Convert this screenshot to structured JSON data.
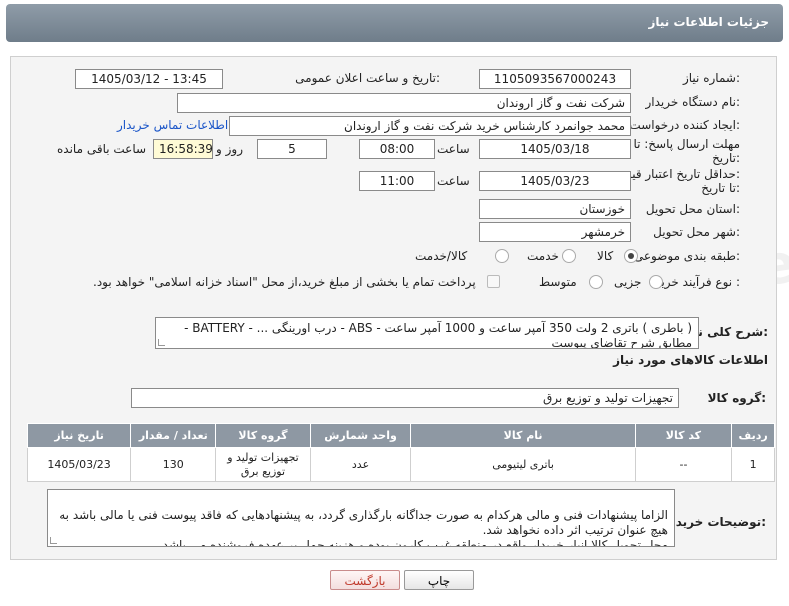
{
  "header": {
    "title": "جزئیات اطلاعات نیاز"
  },
  "form": {
    "need_number_label": "شماره نیاز:",
    "need_number": "1105093567000243",
    "announce_datetime_label": "تاریخ و ساعت اعلان عمومی:",
    "announce_datetime": "1405/03/12 - 13:45",
    "buyer_org_label": "نام دستگاه خریدار:",
    "buyer_org": "شرکت نفت و گاز اروندان",
    "requester_label": "ایجاد کننده درخواست:",
    "requester": "محمد جوانمرد کارشناس خرید شرکت نفت و گاز اروندان",
    "contact_link": "اطلاعات تماس خریدار",
    "reply_deadline_label_1": "مهلت ارسال پاسخ: تا",
    "reply_deadline_label_2": "تاریخ:",
    "reply_date": "1405/03/18",
    "time_label": "ساعت",
    "reply_time": "08:00",
    "days_value": "5",
    "days_label": "روز و",
    "remaining_time": "16:58:39",
    "remaining_label": "ساعت باقی مانده",
    "validity_label_1": "حداقل تاریخ اعتبار قیمت:",
    "validity_label_2": "تا تاریخ:",
    "validity_date": "1405/03/23",
    "validity_time": "11:00",
    "province_label": "استان محل تحویل:",
    "province": "خوزستان",
    "city_label": "شهر محل تحویل:",
    "city": "خرمشهر",
    "category_label": "طبقه بندی موضوعی:",
    "category_options": [
      "کالا",
      "خدمت",
      "کالا/خدمت"
    ],
    "process_label": "نوع فرآیند خرید :",
    "process_options": [
      "جزیی",
      "متوسط"
    ],
    "payment_note": "پرداخت تمام یا بخشی از مبلغ خرید،از محل \"اسناد خزانه اسلامی\" خواهد بود.",
    "summary_label": "شرح کلی نیاز:",
    "summary": "( باطری ) باتری 2 ولت 350 آمپر ساعت و 1000 آمپر ساعت - ABS - درب اورینگی ... - BATTERY - مطابق شرح تقاضای پیوست",
    "goods_info_label": "اطلاعات کالاهای مورد نیاز",
    "goods_group_label": "گروه کالا:",
    "goods_group": "تجهیزات تولید و توزیع برق",
    "buyer_notes_label": "توضیحات خریدار:",
    "buyer_notes": "الزاما پیشنهادات فنی و مالی هرکدام به صورت جداگانه بارگذاری گردد، به پیشنهادهایی که فاقد پیوست فنی یا مالی باشد به هیچ عنوان ترتیب اثر داده نخواهد شد.\nمحل تحویل کالا انبار خریدار واقع در منطقه غرب کارون بوده و هزینه حمل بر عهده فروشنده می باشد."
  },
  "table": {
    "headers": [
      "ردیف",
      "کد کالا",
      "نام کالا",
      "واحد شمارش",
      "گروه کالا",
      "تعداد / مقدار",
      "تاریخ نیاز"
    ],
    "rows": [
      [
        "1",
        "--",
        "باتری لیتیومی",
        "عدد",
        "تجهیزات تولید و توزیع برق",
        "130",
        "1405/03/23"
      ]
    ]
  },
  "buttons": {
    "print": "چاپ",
    "back": "بازگشت"
  },
  "watermark": "AriaTender.net"
}
